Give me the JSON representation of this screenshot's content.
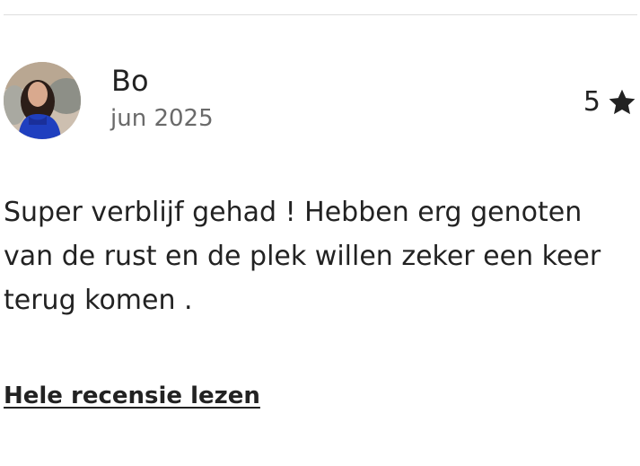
{
  "review": {
    "reviewer_name": "Bo",
    "date": "jun 2025",
    "rating": "5",
    "rating_icon": "star-icon",
    "text": "Super verblijf gehad ! Hebben erg genoten van de rust en de plek willen zeker een keer terug komen .",
    "read_more_label": "Hele recensie lezen"
  },
  "colors": {
    "text_primary": "#222222",
    "text_secondary": "#6a6a6a",
    "divider": "#dddddd"
  }
}
